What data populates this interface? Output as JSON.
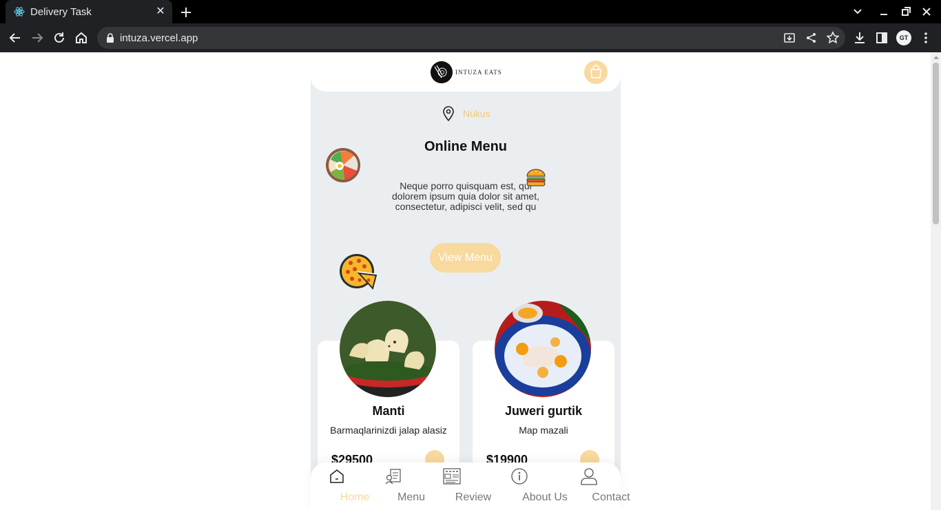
{
  "browser": {
    "tab_title": "Delivery Task",
    "url": "intuza.vercel.app",
    "profile_initials": "GT"
  },
  "app": {
    "brand": "INTUZA EATS",
    "location": "Nukus",
    "hero_title": "Online Menu",
    "hero_description": "Neque porro quisquam est, qui dolorem ipsum quia dolor sit amet, consectetur, adipisci velit, sed qu",
    "cta_label": "View Menu",
    "accent_color": "#f8d99e",
    "products": [
      {
        "name": "Manti",
        "description": "Barmaqlarinizdi jalap alasiz",
        "price": "$29500"
      },
      {
        "name": "Juweri gurtik",
        "description": "Map mazali",
        "price": "$19900"
      }
    ],
    "nav": [
      {
        "label": "Home",
        "icon": "home-icon",
        "active": true
      },
      {
        "label": "Menu",
        "icon": "menu-icon",
        "active": false
      },
      {
        "label": "Review",
        "icon": "review-icon",
        "active": false
      },
      {
        "label": "About Us",
        "icon": "info-icon",
        "active": false
      },
      {
        "label": "Contact",
        "icon": "user-icon",
        "active": false
      }
    ]
  }
}
